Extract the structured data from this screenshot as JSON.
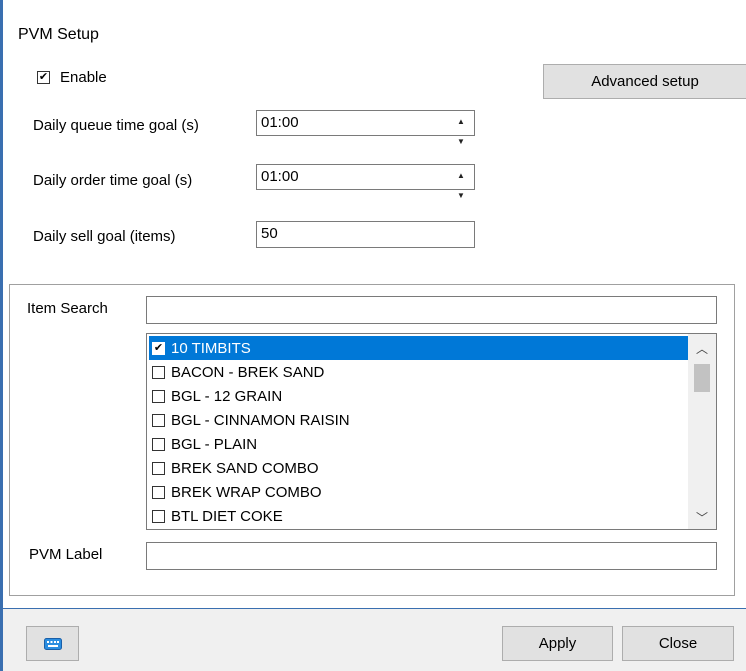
{
  "title": "PVM Setup",
  "enable": {
    "label": "Enable",
    "checked": true
  },
  "advanced_label": "Advanced setup",
  "fields": {
    "queue": {
      "label": "Daily queue time goal (s)",
      "value": "01:00"
    },
    "order": {
      "label": "Daily order time goal (s)",
      "value": "01:00"
    },
    "sell": {
      "label": "Daily sell goal (items)",
      "value": "50"
    }
  },
  "item_search": {
    "label": "Item Search",
    "value": ""
  },
  "items": [
    {
      "label": "10 TIMBITS",
      "checked": true,
      "selected": true
    },
    {
      "label": "BACON - BREK SAND",
      "checked": false,
      "selected": false
    },
    {
      "label": "BGL - 12 GRAIN",
      "checked": false,
      "selected": false
    },
    {
      "label": "BGL - CINNAMON RAISIN",
      "checked": false,
      "selected": false
    },
    {
      "label": "BGL - PLAIN",
      "checked": false,
      "selected": false
    },
    {
      "label": "BREK SAND COMBO",
      "checked": false,
      "selected": false
    },
    {
      "label": "BREK WRAP COMBO",
      "checked": false,
      "selected": false
    },
    {
      "label": "BTL DIET COKE",
      "checked": false,
      "selected": false
    }
  ],
  "pvm_label": {
    "label": "PVM Label",
    "value": ""
  },
  "footer": {
    "apply_label": "Apply",
    "close_label": "Close"
  },
  "icons": {
    "keyboard": "keyboard-icon"
  },
  "colors": {
    "accent": "#0078d7",
    "border_accent": "#3a6fb0"
  }
}
